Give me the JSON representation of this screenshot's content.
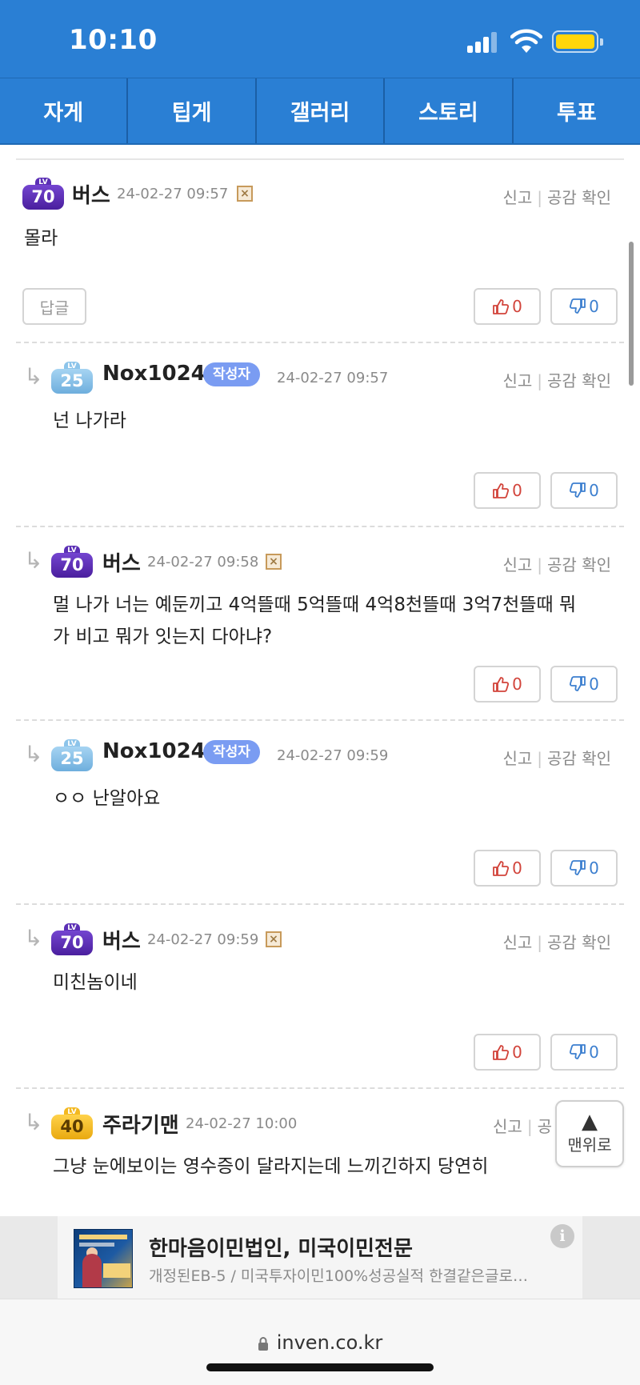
{
  "status": {
    "time": "10:10"
  },
  "nav": {
    "tabs": [
      "자게",
      "팁게",
      "갤러리",
      "스토리",
      "투표"
    ]
  },
  "comments": [
    {
      "level": "70",
      "nick": "버스",
      "date": "24-02-27 09:57",
      "text": "몰라",
      "reply_label": "답글",
      "report": "신고",
      "like_check": "공감 확인",
      "up": "0",
      "down": "0"
    },
    {
      "level": "25",
      "nick": "Nox1024",
      "badge": "작성자",
      "date": "24-02-27 09:57",
      "text": "넌 나가라",
      "report": "신고",
      "like_check": "공감 확인",
      "up": "0",
      "down": "0"
    },
    {
      "level": "70",
      "nick": "버스",
      "date": "24-02-27 09:58",
      "text_line1": "멀 나가 너는 예둔끼고 4억뜰때 5억뜰때 4억8천뜰때 3억7천뜰때 뭐",
      "text_line2": "가 비고 뭐가 잇는지 다아냐?",
      "report": "신고",
      "like_check": "공감 확인",
      "up": "0",
      "down": "0"
    },
    {
      "level": "25",
      "nick": "Nox1024",
      "badge": "작성자",
      "date": "24-02-27 09:59",
      "text": "ㅇㅇ 난알아요",
      "report": "신고",
      "like_check": "공감 확인",
      "up": "0",
      "down": "0"
    },
    {
      "level": "70",
      "nick": "버스",
      "date": "24-02-27 09:59",
      "text": "미친놈이네",
      "report": "신고",
      "like_check": "공감 확인",
      "up": "0",
      "down": "0"
    },
    {
      "level": "40",
      "nick": "주라기맨",
      "date": "24-02-27 10:00",
      "text": "그냥 눈에보이는 영수증이 달라지는데 느끼긴하지 당연히",
      "report": "신고",
      "like_check": "공"
    }
  ],
  "lv_tag": "LV",
  "xmark": "×",
  "reply_arrow": "↳",
  "scroll_top": {
    "arrow": "▲",
    "label": "맨위로"
  },
  "ad": {
    "title": "한마음이민법인, 미국이민전문",
    "subtitle": "개정된EB-5 / 미국투자이민100%성공실적 한결같은글로…",
    "info": "i"
  },
  "url": "inven.co.kr",
  "colors": {
    "header": "#2a7fd4",
    "author_badge": "#7a9cf2",
    "up": "#d2443b",
    "down": "#3c7fcf"
  }
}
